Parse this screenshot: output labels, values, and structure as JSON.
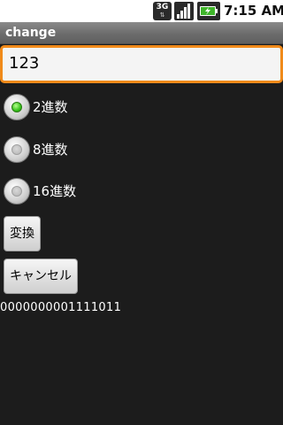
{
  "status_bar": {
    "network_type": "3G",
    "network_arrows": "⇅",
    "time": "7:15 AM",
    "icons": [
      "3g-icon",
      "signal-icon",
      "battery-charging-icon"
    ]
  },
  "app": {
    "title": "change"
  },
  "input": {
    "value": "123"
  },
  "radios": [
    {
      "label": "2進数",
      "checked": true
    },
    {
      "label": "8進数",
      "checked": false
    },
    {
      "label": "16進数",
      "checked": false
    }
  ],
  "buttons": {
    "convert_label": "変換",
    "cancel_label": "キャンセル"
  },
  "result": {
    "text": "0000000001111011"
  },
  "colors": {
    "background": "#1c1c1c",
    "focus_border": "#f08a1a",
    "radio_checked": "#36c21a",
    "title_bar": "#6c6c6c"
  }
}
